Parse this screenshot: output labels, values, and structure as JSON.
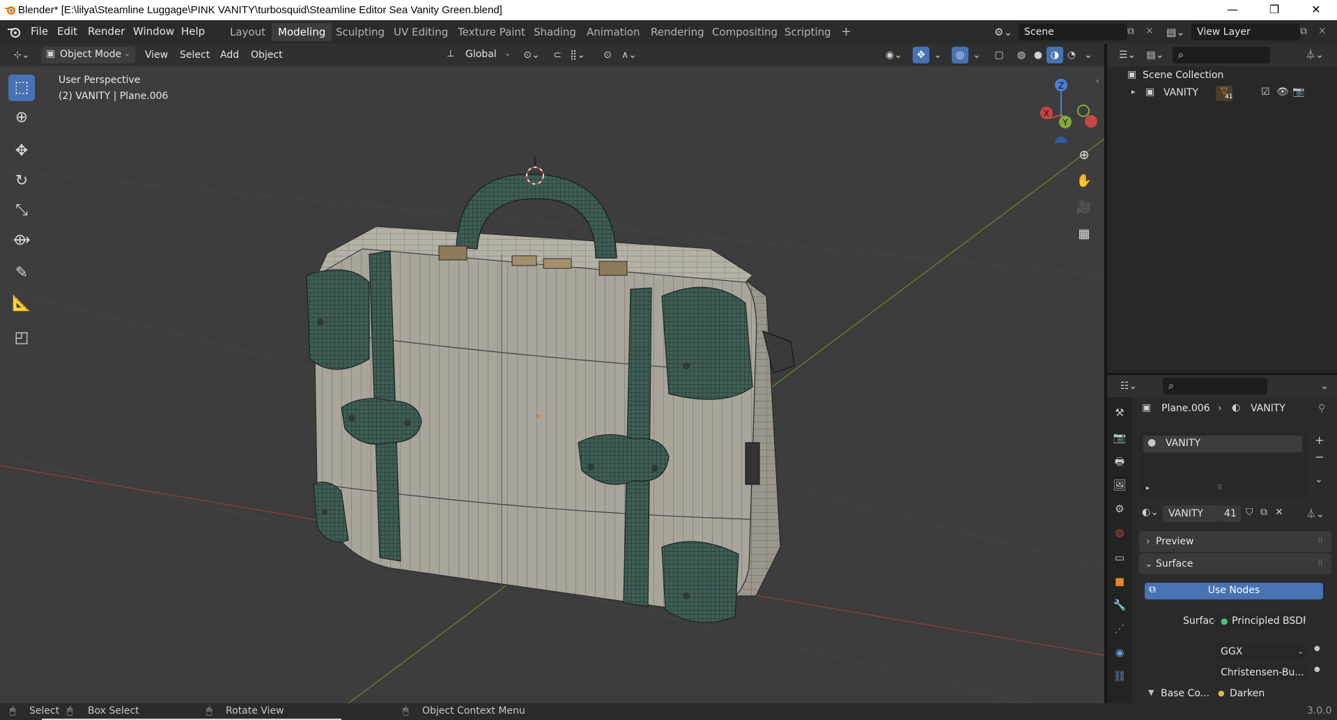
{
  "window": {
    "title": "Blender* [E:\\lilya\\Steamline Luggage\\PINK VANITY\\turbosquid\\Steamline Editor Sea Vanity Green.blend]",
    "minimize": "—",
    "maximize": "❐",
    "close": "✕"
  },
  "menus": [
    "File",
    "Edit",
    "Render",
    "Window",
    "Help"
  ],
  "workspaces": [
    "Layout",
    "Modeling",
    "Sculpting",
    "UV Editing",
    "Texture Paint",
    "Shading",
    "Animation",
    "Rendering",
    "Compositing",
    "Scripting"
  ],
  "active_workspace": "Modeling",
  "scene": {
    "label": "Scene",
    "view_layer": "View Layer"
  },
  "viewport_header": {
    "mode": "Object Mode",
    "menus": [
      "View",
      "Select",
      "Add",
      "Object"
    ],
    "orientation": "Global"
  },
  "viewport": {
    "perspective": "User Perspective",
    "object_info": "(2)  VANITY | Plane.006",
    "gizmo": {
      "z": "Z",
      "y": "Y",
      "x": "X"
    }
  },
  "outliner": {
    "root": "Scene Collection",
    "items": [
      {
        "label": "VANITY",
        "count": "41"
      }
    ]
  },
  "properties": {
    "breadcrumb_object": "Plane.006",
    "breadcrumb_material": "VANITY",
    "slot": "VANITY",
    "material_name": "VANITY",
    "users": "41",
    "panels": {
      "preview": "Preview",
      "surface": "Surface"
    },
    "use_nodes": "Use Nodes",
    "surface_label": "Surface",
    "surface_value": "Principled BSDF",
    "distribution": "GGX",
    "subsurface": "Christensen-Bu...",
    "base_color_label": "Base Co...",
    "base_color_value": "Darken"
  },
  "statusbar": {
    "select": "Select",
    "box_select": "Box Select",
    "rotate": "Rotate View",
    "context": "Object Context Menu",
    "version": "3.0.0"
  },
  "colors": {
    "accent": "#4772b3",
    "mesh_green": "#3d5a52",
    "case_body": "#a8a49a",
    "x_axis": "#c94545",
    "y_axis": "#86a83a",
    "z_axis": "#4a7fd6"
  }
}
